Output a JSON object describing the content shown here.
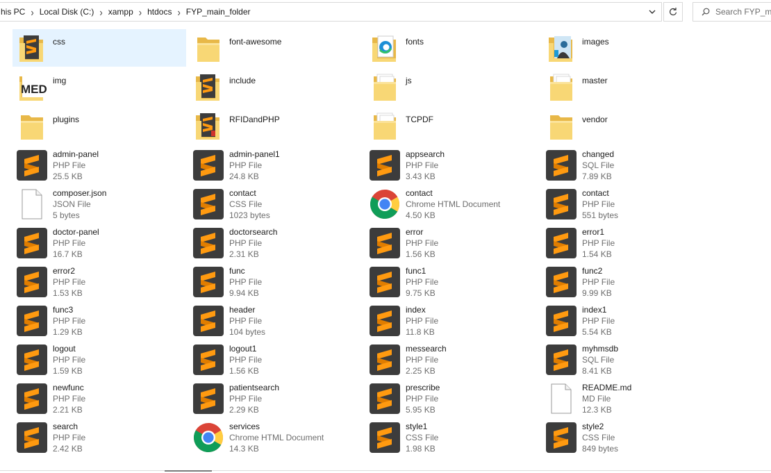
{
  "address_bar": {
    "crumbs": [
      "his PC",
      "Local Disk (C:)",
      "xampp",
      "htdocs",
      "FYP_main_folder"
    ]
  },
  "search": {
    "placeholder": "Search FYP_main_folder"
  },
  "colors": {
    "selection": "#e5f3ff",
    "folder": "#f7c95a",
    "sublime": "#3c3c3c",
    "sublime_s": "#ff9800"
  },
  "items": [
    {
      "name": "css",
      "kind": "folder",
      "icon": "folder-sublime-icon",
      "selected": true
    },
    {
      "name": "font-awesome",
      "kind": "folder",
      "icon": "folder-icon"
    },
    {
      "name": "fonts",
      "kind": "folder",
      "icon": "folder-edge-icon"
    },
    {
      "name": "images",
      "kind": "folder",
      "icon": "folder-image-icon"
    },
    {
      "name": "img",
      "kind": "folder",
      "icon": "folder-med-icon"
    },
    {
      "name": "include",
      "kind": "folder",
      "icon": "folder-sublime-icon"
    },
    {
      "name": "js",
      "kind": "folder",
      "icon": "folder-docs-icon"
    },
    {
      "name": "master",
      "kind": "folder",
      "icon": "folder-docs-icon"
    },
    {
      "name": "plugins",
      "kind": "folder",
      "icon": "folder-icon"
    },
    {
      "name": "RFIDandPHP",
      "kind": "folder",
      "icon": "folder-sublime-red-icon"
    },
    {
      "name": "TCPDF",
      "kind": "folder",
      "icon": "folder-docs-icon"
    },
    {
      "name": "vendor",
      "kind": "folder",
      "icon": "folder-icon"
    },
    {
      "name": "admin-panel",
      "kind": "file",
      "type": "PHP File",
      "size": "25.5 KB",
      "icon": "sublime-icon"
    },
    {
      "name": "admin-panel1",
      "kind": "file",
      "type": "PHP File",
      "size": "24.8 KB",
      "icon": "sublime-icon"
    },
    {
      "name": "appsearch",
      "kind": "file",
      "type": "PHP File",
      "size": "3.43 KB",
      "icon": "sublime-icon"
    },
    {
      "name": "changed",
      "kind": "file",
      "type": "SQL File",
      "size": "7.89 KB",
      "icon": "sublime-icon"
    },
    {
      "name": "composer.json",
      "kind": "file",
      "type": "JSON File",
      "size": "5 bytes",
      "icon": "blank-file-icon"
    },
    {
      "name": "contact",
      "kind": "file",
      "type": "CSS File",
      "size": "1023 bytes",
      "icon": "sublime-icon"
    },
    {
      "name": "contact",
      "kind": "file",
      "type": "Chrome HTML Document",
      "size": "4.50 KB",
      "icon": "chrome-icon"
    },
    {
      "name": "contact",
      "kind": "file",
      "type": "PHP File",
      "size": "551 bytes",
      "icon": "sublime-icon"
    },
    {
      "name": "doctor-panel",
      "kind": "file",
      "type": "PHP File",
      "size": "16.7 KB",
      "icon": "sublime-icon"
    },
    {
      "name": "doctorsearch",
      "kind": "file",
      "type": "PHP File",
      "size": "2.31 KB",
      "icon": "sublime-icon"
    },
    {
      "name": "error",
      "kind": "file",
      "type": "PHP File",
      "size": "1.56 KB",
      "icon": "sublime-icon"
    },
    {
      "name": "error1",
      "kind": "file",
      "type": "PHP File",
      "size": "1.54 KB",
      "icon": "sublime-icon"
    },
    {
      "name": "error2",
      "kind": "file",
      "type": "PHP File",
      "size": "1.53 KB",
      "icon": "sublime-icon"
    },
    {
      "name": "func",
      "kind": "file",
      "type": "PHP File",
      "size": "9.94 KB",
      "icon": "sublime-icon"
    },
    {
      "name": "func1",
      "kind": "file",
      "type": "PHP File",
      "size": "9.75 KB",
      "icon": "sublime-icon"
    },
    {
      "name": "func2",
      "kind": "file",
      "type": "PHP File",
      "size": "9.99 KB",
      "icon": "sublime-icon"
    },
    {
      "name": "func3",
      "kind": "file",
      "type": "PHP File",
      "size": "1.29 KB",
      "icon": "sublime-icon"
    },
    {
      "name": "header",
      "kind": "file",
      "type": "PHP File",
      "size": "104 bytes",
      "icon": "sublime-icon"
    },
    {
      "name": "index",
      "kind": "file",
      "type": "PHP File",
      "size": "11.8 KB",
      "icon": "sublime-icon"
    },
    {
      "name": "index1",
      "kind": "file",
      "type": "PHP File",
      "size": "5.54 KB",
      "icon": "sublime-icon"
    },
    {
      "name": "logout",
      "kind": "file",
      "type": "PHP File",
      "size": "1.59 KB",
      "icon": "sublime-icon"
    },
    {
      "name": "logout1",
      "kind": "file",
      "type": "PHP File",
      "size": "1.56 KB",
      "icon": "sublime-icon"
    },
    {
      "name": "messearch",
      "kind": "file",
      "type": "PHP File",
      "size": "2.25 KB",
      "icon": "sublime-icon"
    },
    {
      "name": "myhmsdb",
      "kind": "file",
      "type": "SQL File",
      "size": "8.41 KB",
      "icon": "sublime-icon"
    },
    {
      "name": "newfunc",
      "kind": "file",
      "type": "PHP File",
      "size": "2.21 KB",
      "icon": "sublime-icon"
    },
    {
      "name": "patientsearch",
      "kind": "file",
      "type": "PHP File",
      "size": "2.29 KB",
      "icon": "sublime-icon"
    },
    {
      "name": "prescribe",
      "kind": "file",
      "type": "PHP File",
      "size": "5.95 KB",
      "icon": "sublime-icon"
    },
    {
      "name": "README.md",
      "kind": "file",
      "type": "MD File",
      "size": "12.3 KB",
      "icon": "blank-file-icon"
    },
    {
      "name": "search",
      "kind": "file",
      "type": "PHP File",
      "size": "2.42 KB",
      "icon": "sublime-icon"
    },
    {
      "name": "services",
      "kind": "file",
      "type": "Chrome HTML Document",
      "size": "14.3 KB",
      "icon": "chrome-icon"
    },
    {
      "name": "style1",
      "kind": "file",
      "type": "CSS File",
      "size": "1.98 KB",
      "icon": "sublime-icon"
    },
    {
      "name": "style2",
      "kind": "file",
      "type": "CSS File",
      "size": "849 bytes",
      "icon": "sublime-icon"
    }
  ]
}
